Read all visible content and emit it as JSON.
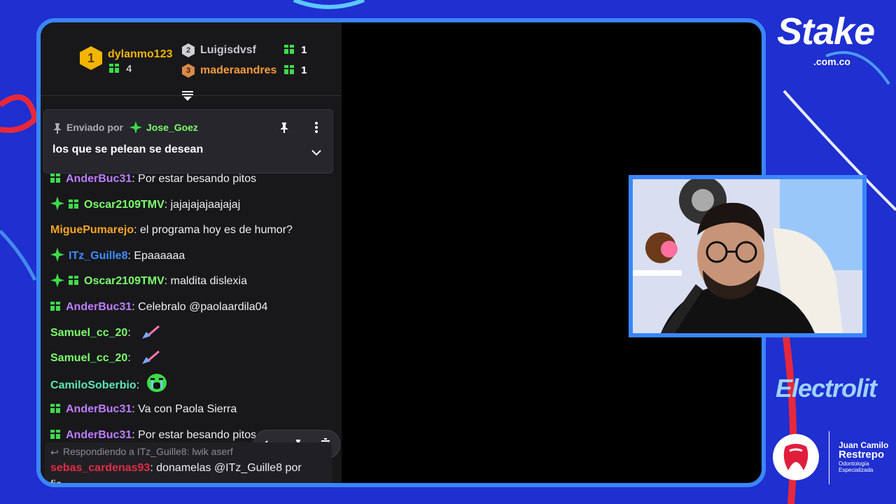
{
  "leaderboard": {
    "first": {
      "rank": "1",
      "name": "dylanmo123",
      "gifts": "4"
    },
    "second": {
      "rank": "2",
      "name": "Luigisdvsf",
      "gifts": "1"
    },
    "third": {
      "rank": "3",
      "name": "maderaandres",
      "gifts": "1"
    }
  },
  "pinned": {
    "sent_by_label": "Enviado por",
    "user": "Jose_Goez",
    "message": "los que se pelean se desean"
  },
  "messages": [
    {
      "user": "AnderBuc31",
      "text": ": Por estar besando pitos",
      "color": "#bf7cff",
      "badges": [
        "gift"
      ]
    },
    {
      "user": "Oscar2109TMV",
      "text": ": jajajajajaajajaj",
      "color": "#7cff6a",
      "badges": [
        "sparkle",
        "gift"
      ]
    },
    {
      "user": "MiguePumarejo",
      "text": ": el programa hoy es de humor?",
      "color": "#f5a623",
      "badges": []
    },
    {
      "user": "ITz_Guille8",
      "text": ": Epaaaaaa",
      "color": "#3d8cff",
      "badges": [
        "sparkle"
      ]
    },
    {
      "user": "Oscar2109TMV",
      "text": ": maldita dislexia",
      "color": "#7cff6a",
      "badges": [
        "sparkle",
        "gift"
      ]
    },
    {
      "user": "AnderBuc31",
      "text": ": Celebralo @paolaardila04",
      "color": "#bf7cff",
      "badges": [
        "gift"
      ]
    },
    {
      "user": "Samuel_cc_20",
      "text": ":",
      "color": "#7cff6a",
      "badges": [],
      "emote": "broom"
    },
    {
      "user": "Samuel_cc_20",
      "text": ":",
      "color": "#7cff6a",
      "badges": [],
      "emote": "broom"
    },
    {
      "user": "CamiloSoberbio",
      "text": ":",
      "color": "#5ce6b0",
      "badges": [],
      "emote": "crying"
    },
    {
      "user": "AnderBuc31",
      "text": ": Va con Paola Sierra",
      "color": "#bf7cff",
      "badges": [
        "gift"
      ]
    },
    {
      "user": "AnderBuc31",
      "text": ": Por estar besando pitos",
      "color": "#bf7cff",
      "badges": [
        "gift"
      ]
    }
  ],
  "reply": {
    "label": "Respondiendo a ITz_Guille8: lwik aserf",
    "user": "sebas_cardenas93",
    "text": ": donamelas @ITz_Guille8 por",
    "text2": "fis"
  },
  "sponsors": {
    "stake": "Stake",
    "stake_sub": ".com.co",
    "electrolit": "Electrolit",
    "jcr_line1": "Juan Camilo",
    "jcr_line2": "Restrepo",
    "jcr_line3": "Odontología",
    "jcr_line4": "Especializada"
  },
  "colors": {
    "frame": "#3a86ff",
    "background": "#1f2fd0",
    "gift": "#3ddc4a"
  },
  "icons": [
    "pin-icon",
    "more-icon",
    "chevron-down-icon",
    "undo-icon",
    "trash-icon",
    "gift-icon",
    "sparkle-icon",
    "collapse-icon"
  ]
}
